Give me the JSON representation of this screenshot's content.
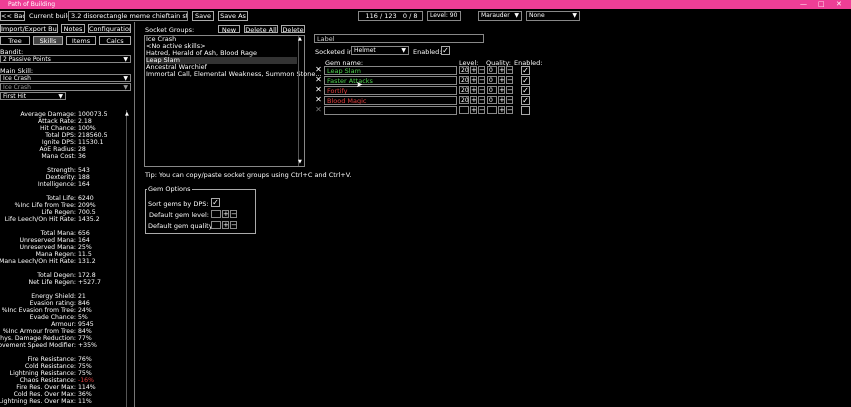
{
  "app": {
    "title": "Path of Building"
  },
  "toolbar": {
    "back": "<< Back",
    "current_build_label": "Current build:",
    "build_name": "3.2 disorectangle meme chieftain starter",
    "save": "Save",
    "save_as": "Save As",
    "points": "116 / 123",
    "ascend_points": "0 / 8",
    "level": "Level: 90",
    "class": "Marauder",
    "ascendancy": "None"
  },
  "tabs": {
    "import_export": "Import/Export Build",
    "notes": "Notes",
    "configuration": "Configuration",
    "tree": "Tree",
    "skills": "Skills",
    "items": "Items",
    "calcs": "Calcs"
  },
  "left": {
    "bandit_label": "Bandit:",
    "bandit_value": "2 Passive Points",
    "main_skill_label": "Main Skill:",
    "main_skill_value": "Ice Crash",
    "main_skill_part": "Ice Crash",
    "hit_type": "First Hit"
  },
  "stats": [
    {
      "k": "Average Damage:",
      "v": "100073.5"
    },
    {
      "k": "Attack Rate:",
      "v": "2.18"
    },
    {
      "k": "Hit Chance:",
      "v": "100%"
    },
    {
      "k": "Total DPS:",
      "v": "218560.5"
    },
    {
      "k": "Ignite DPS:",
      "v": "11530.1"
    },
    {
      "k": "AoE Radius:",
      "v": "28"
    },
    {
      "k": "Mana Cost:",
      "v": "36"
    },
    {
      "k": "",
      "v": ""
    },
    {
      "k": "Strength:",
      "v": "543"
    },
    {
      "k": "Dexterity:",
      "v": "188"
    },
    {
      "k": "Intelligence:",
      "v": "164"
    },
    {
      "k": "",
      "v": ""
    },
    {
      "k": "Total Life:",
      "v": "6240"
    },
    {
      "k": "%Inc Life from Tree:",
      "v": "209%"
    },
    {
      "k": "Life Regen:",
      "v": "700.5"
    },
    {
      "k": "Life Leech/On Hit Rate:",
      "v": "1435.2"
    },
    {
      "k": "",
      "v": ""
    },
    {
      "k": "Total Mana:",
      "v": "656"
    },
    {
      "k": "Unreserved Mana:",
      "v": "164"
    },
    {
      "k": "Unreserved Mana:",
      "v": "25%"
    },
    {
      "k": "Mana Regen:",
      "v": "11.5"
    },
    {
      "k": "Mana Leech/On Hit Rate:",
      "v": "131.2"
    },
    {
      "k": "",
      "v": ""
    },
    {
      "k": "Total Degen:",
      "v": "172.8"
    },
    {
      "k": "Net Life Regen:",
      "v": "+527.7"
    },
    {
      "k": "",
      "v": ""
    },
    {
      "k": "Energy Shield:",
      "v": "21"
    },
    {
      "k": "Evasion rating:",
      "v": "846"
    },
    {
      "k": "%Inc Evasion from Tree:",
      "v": "24%"
    },
    {
      "k": "Evade Chance:",
      "v": "5%"
    },
    {
      "k": "Armour:",
      "v": "9545"
    },
    {
      "k": "%Inc Armour from Tree:",
      "v": "84%"
    },
    {
      "k": "Phys. Damage Reduction:",
      "v": "77%"
    },
    {
      "k": "Movement Speed Modifier:",
      "v": "+35%"
    },
    {
      "k": "",
      "v": ""
    },
    {
      "k": "Fire Resistance:",
      "v": "76%"
    },
    {
      "k": "Cold Resistance:",
      "v": "75%"
    },
    {
      "k": "Lightning Resistance:",
      "v": "75%"
    },
    {
      "k": "Chaos Resistance:",
      "v": "-16%",
      "red": true
    },
    {
      "k": "Fire Res. Over Max:",
      "v": "114%"
    },
    {
      "k": "Cold Res. Over Max:",
      "v": "36%"
    },
    {
      "k": "Lightning Res. Over Max:",
      "v": "11%"
    }
  ],
  "socket_groups": {
    "label": "Socket Groups:",
    "new": "New",
    "delete_all": "Delete All",
    "delete": "Delete",
    "items": [
      "Ice Crash",
      "<No active skills>",
      "Hatred, Herald of Ash, Blood Rage",
      "Leap Slam",
      "Ancestral Warchief",
      "Immortal Call, Elemental Weakness, Summon Stone..."
    ],
    "tip": "Tip: You can copy/paste socket groups using Ctrl+C and Ctrl+V."
  },
  "group_editor": {
    "label_placeholder": "Label",
    "socketed_in_label": "Socketed in:",
    "socketed_in_value": "Helmet",
    "enabled_label": "Enabled:",
    "col_gem": "Gem name:",
    "col_level": "Level:",
    "col_quality": "Quality:",
    "col_enabled": "Enabled:",
    "gems": [
      {
        "name": "Leap Slam",
        "level": "20",
        "quality": "0",
        "color": "#4fd14f",
        "enabled": true
      },
      {
        "name": "Faster Attacks",
        "level": "20",
        "quality": "0",
        "color": "#4fd14f",
        "enabled": true
      },
      {
        "name": "Fortify",
        "level": "20",
        "quality": "0",
        "color": "#e04040",
        "enabled": true
      },
      {
        "name": "Blood Magic",
        "level": "20",
        "quality": "0",
        "color": "#e04040",
        "enabled": true
      },
      {
        "name": "",
        "level": "",
        "quality": "",
        "color": "#ffffff",
        "enabled": false
      }
    ]
  },
  "gem_options": {
    "title": "Gem Options",
    "sort": "Sort gems by DPS:",
    "default_level": "Default gem level:",
    "default_quality": "Default gem quality:"
  },
  "window_controls": {
    "min": "—",
    "max": "□",
    "close": "✕"
  }
}
